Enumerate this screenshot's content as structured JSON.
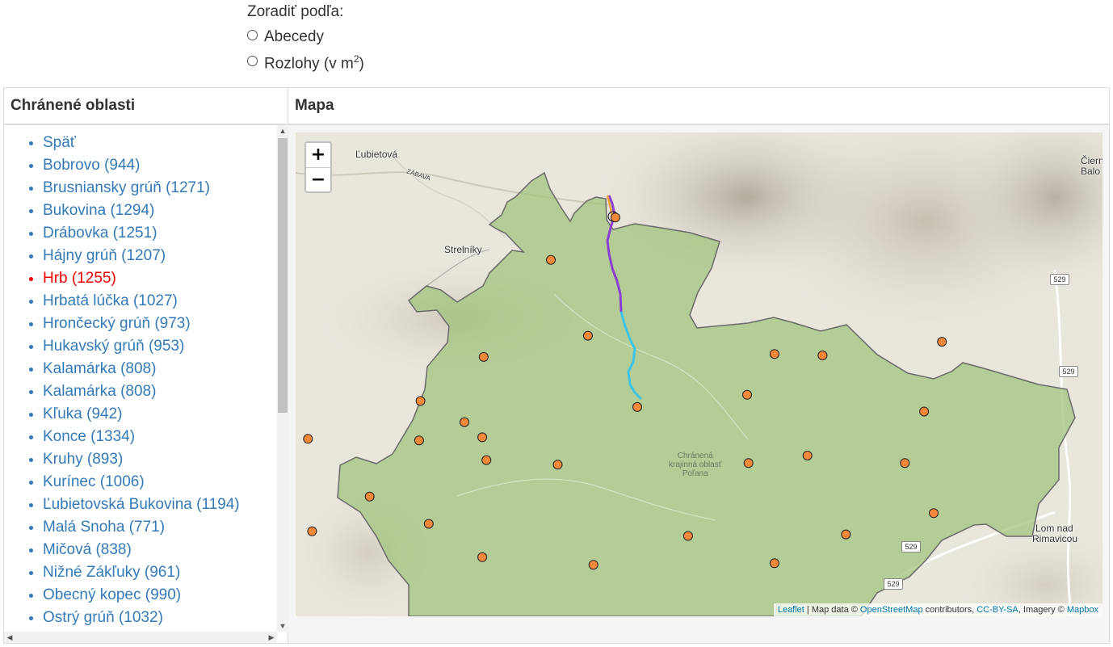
{
  "sort": {
    "label": "Zoradiť podľa:",
    "options": [
      "Abecedy",
      "Rozlohy (v m",
      "2",
      ")"
    ]
  },
  "table": {
    "left_header": "Chránené oblasti",
    "right_header": "Mapa"
  },
  "list": {
    "items": [
      "Späť",
      "Bobrovo (944)",
      "Brusniansky grúň (1271)",
      "Bukovina (1294)",
      "Drábovka (1251)",
      "Hájny grúň (1207)",
      "Hrb (1255)",
      "Hrbatá lúčka (1027)",
      "Hrončecký grúň (973)",
      "Hukavský grúň (953)",
      "Kalamárka (808)",
      "Kalamárka (808)",
      "Kľuka (942)",
      "Konce (1334)",
      "Kruhy (893)",
      "Kurínec (1006)",
      "Ľubietovská Bukovina (1194)",
      "Malá Snoha (771)",
      "Mičová (838)",
      "Nižné Zákľuky (961)",
      "Obecný kopec (990)",
      "Ostrý grúň (1032)"
    ],
    "active_index": 6
  },
  "map": {
    "zoom_in": "+",
    "zoom_out": "−",
    "places": [
      "Ľubietová",
      "Strelníky",
      "Čiern",
      "Balo",
      "Lom nad",
      "Rimavicou",
      "ZÁBAVA"
    ],
    "area_label": [
      "Chránená",
      "krajinná oblasť",
      "Poľana"
    ],
    "road_numbers": [
      "529",
      "529",
      "529",
      "529"
    ],
    "attribution": {
      "leaflet": "Leaflet",
      "sep1": " | Map data © ",
      "osm": "OpenStreetMap",
      "contributors": " contributors, ",
      "license": "CC-BY-SA",
      "imagery": ", Imagery © ",
      "mapbox": "Mapbox"
    },
    "colors": {
      "area_fill": "#9fc27a",
      "marker": "#f4883a",
      "route_purple": "#8a3fd1",
      "route_cyan": "#3dc4e6",
      "route_orange": "#f0a020"
    },
    "markers": [
      {
        "lat": 48.751,
        "lon": 19.404
      },
      {
        "lat": 48.737,
        "lon": 19.3805
      },
      {
        "lat": 48.712,
        "lon": 19.394
      },
      {
        "lat": 48.705,
        "lon": 19.356
      },
      {
        "lat": 48.706,
        "lon": 19.462
      },
      {
        "lat": 48.7055,
        "lon": 19.4795
      },
      {
        "lat": 48.71,
        "lon": 19.523
      },
      {
        "lat": 48.6925,
        "lon": 19.452
      },
      {
        "lat": 48.6885,
        "lon": 19.412
      },
      {
        "lat": 48.687,
        "lon": 19.5165
      },
      {
        "lat": 48.6905,
        "lon": 19.333
      },
      {
        "lat": 48.6835,
        "lon": 19.349
      },
      {
        "lat": 48.6785,
        "lon": 19.3555
      },
      {
        "lat": 48.6775,
        "lon": 19.3325
      },
      {
        "lat": 48.6725,
        "lon": 19.474
      },
      {
        "lat": 48.671,
        "lon": 19.357
      },
      {
        "lat": 48.6695,
        "lon": 19.383
      },
      {
        "lat": 48.67,
        "lon": 19.4525
      },
      {
        "lat": 48.67,
        "lon": 19.5095
      },
      {
        "lat": 48.678,
        "lon": 19.292
      },
      {
        "lat": 48.659,
        "lon": 19.3145
      },
      {
        "lat": 48.6535,
        "lon": 19.52
      },
      {
        "lat": 48.65,
        "lon": 19.336
      },
      {
        "lat": 48.6475,
        "lon": 19.2935
      },
      {
        "lat": 48.646,
        "lon": 19.4305
      },
      {
        "lat": 48.6465,
        "lon": 19.488
      },
      {
        "lat": 48.639,
        "lon": 19.3555
      },
      {
        "lat": 48.6365,
        "lon": 19.396
      },
      {
        "lat": 48.637,
        "lon": 19.462
      }
    ]
  }
}
